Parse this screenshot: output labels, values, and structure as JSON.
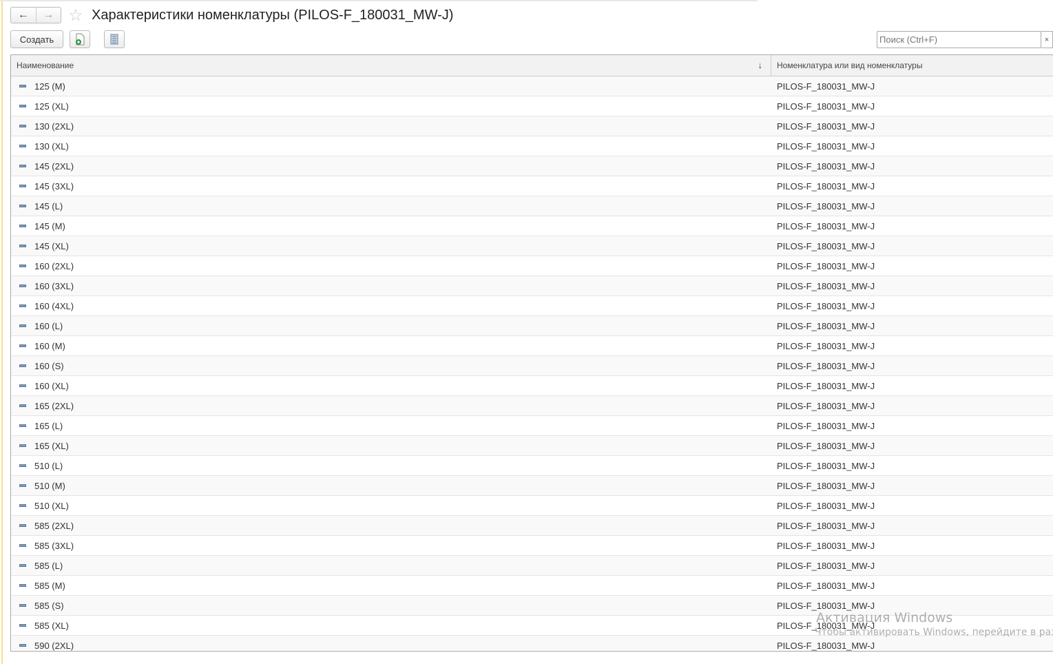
{
  "window": {
    "title": "Характеристики номенклатуры (PILOS-F_180031_MW-J)",
    "back": "←",
    "forward": "→",
    "star": "☆"
  },
  "toolbar": {
    "create_label": "Создать",
    "search_placeholder": "Поиск (Ctrl+F)",
    "clear": "×"
  },
  "table": {
    "columns": [
      "Наименование",
      "Номенклатура или вид номенклатуры"
    ],
    "sort_indicator": "↓",
    "rows": [
      [
        "125 (M)",
        "PILOS-F_180031_MW-J"
      ],
      [
        "125 (XL)",
        "PILOS-F_180031_MW-J"
      ],
      [
        "130 (2XL)",
        "PILOS-F_180031_MW-J"
      ],
      [
        "130 (XL)",
        "PILOS-F_180031_MW-J"
      ],
      [
        "145 (2XL)",
        "PILOS-F_180031_MW-J"
      ],
      [
        "145 (3XL)",
        "PILOS-F_180031_MW-J"
      ],
      [
        "145 (L)",
        "PILOS-F_180031_MW-J"
      ],
      [
        "145 (M)",
        "PILOS-F_180031_MW-J"
      ],
      [
        "145 (XL)",
        "PILOS-F_180031_MW-J"
      ],
      [
        "160 (2XL)",
        "PILOS-F_180031_MW-J"
      ],
      [
        "160 (3XL)",
        "PILOS-F_180031_MW-J"
      ],
      [
        "160 (4XL)",
        "PILOS-F_180031_MW-J"
      ],
      [
        "160 (L)",
        "PILOS-F_180031_MW-J"
      ],
      [
        "160 (M)",
        "PILOS-F_180031_MW-J"
      ],
      [
        "160 (S)",
        "PILOS-F_180031_MW-J"
      ],
      [
        "160 (XL)",
        "PILOS-F_180031_MW-J"
      ],
      [
        "165 (2XL)",
        "PILOS-F_180031_MW-J"
      ],
      [
        "165 (L)",
        "PILOS-F_180031_MW-J"
      ],
      [
        "165 (XL)",
        "PILOS-F_180031_MW-J"
      ],
      [
        "510 (L)",
        "PILOS-F_180031_MW-J"
      ],
      [
        "510 (M)",
        "PILOS-F_180031_MW-J"
      ],
      [
        "510 (XL)",
        "PILOS-F_180031_MW-J"
      ],
      [
        "585 (2XL)",
        "PILOS-F_180031_MW-J"
      ],
      [
        "585 (3XL)",
        "PILOS-F_180031_MW-J"
      ],
      [
        "585 (L)",
        "PILOS-F_180031_MW-J"
      ],
      [
        "585 (M)",
        "PILOS-F_180031_MW-J"
      ],
      [
        "585 (S)",
        "PILOS-F_180031_MW-J"
      ],
      [
        "585 (XL)",
        "PILOS-F_180031_MW-J"
      ],
      [
        "590 (2XL)",
        "PILOS-F_180031_MW-J"
      ]
    ]
  },
  "watermark": {
    "title": "Активация Windows",
    "subtitle": "Чтобы активировать Windows, перейдите в разде"
  }
}
